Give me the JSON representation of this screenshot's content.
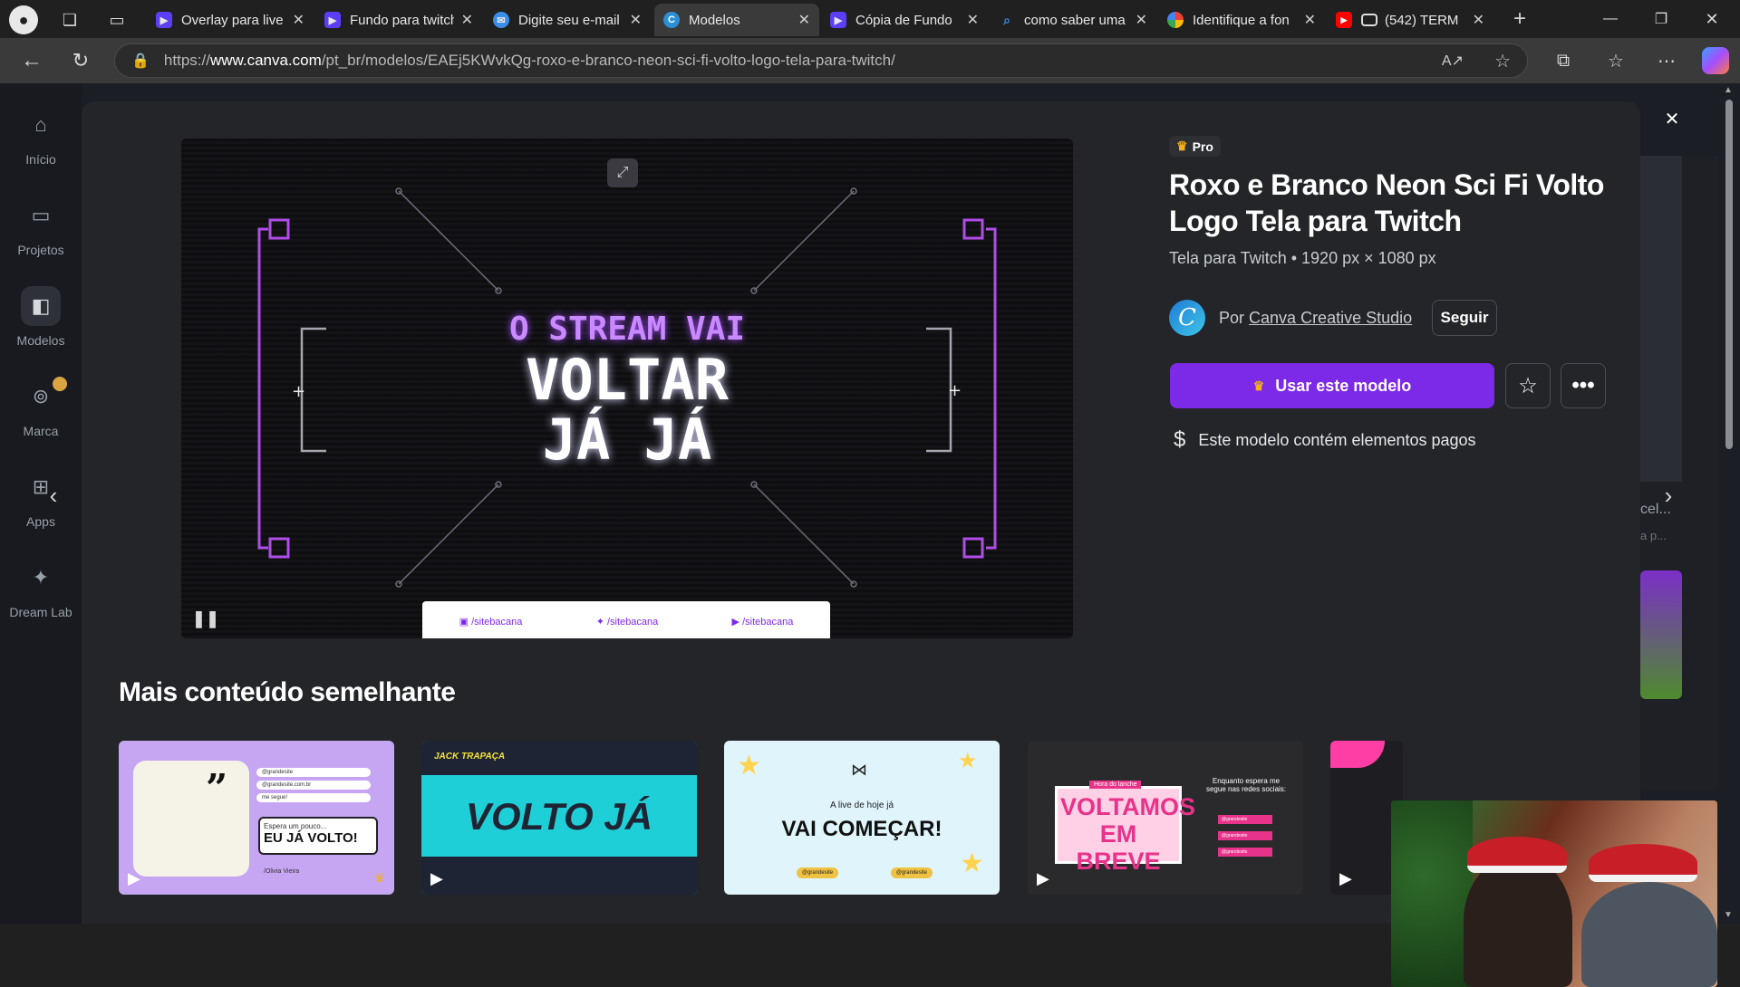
{
  "browser": {
    "tabs": [
      {
        "title": "Overlay para live",
        "favicon": "canva-video"
      },
      {
        "title": "Fundo para twitch",
        "favicon": "canva-video"
      },
      {
        "title": "Digite seu e-mail",
        "favicon": "mail"
      },
      {
        "title": "Modelos",
        "favicon": "canva",
        "active": true
      },
      {
        "title": "Cópia de Fundo",
        "favicon": "canva-video"
      },
      {
        "title": "como saber uma",
        "favicon": "search"
      },
      {
        "title": "Identifique a fon",
        "favicon": "google"
      },
      {
        "title": "(542) TERM",
        "favicon": "youtube"
      }
    ],
    "url_prefix": "https://",
    "url_domain": "www.canva.com",
    "url_path": "/pt_br/modelos/EAEj5KWvkQg-roxo-e-branco-neon-sci-fi-volto-logo-tela-para-twitch/"
  },
  "sidebar": {
    "items": [
      {
        "label": "Início",
        "icon": "home-icon"
      },
      {
        "label": "Projetos",
        "icon": "folder-icon"
      },
      {
        "label": "Modelos",
        "icon": "templates-icon"
      },
      {
        "label": "Marca",
        "icon": "brand-icon"
      },
      {
        "label": "Apps",
        "icon": "apps-icon"
      },
      {
        "label": "Dream Lab",
        "icon": "dreamlab-icon"
      }
    ]
  },
  "template": {
    "badge": "Pro",
    "title": "Roxo e Branco Neon Sci Fi Volto Logo Tela para Twitch",
    "meta": "Tela para Twitch • 1920 px × 1080 px",
    "author_prefix": "Por",
    "author": "Canva Creative Studio",
    "follow_label": "Seguir",
    "use_label": "Usar este modelo",
    "paid_note": "Este modelo contém elementos pagos"
  },
  "preview": {
    "line1": "O STREAM VAI",
    "line2": "VOLTAR",
    "line3": "JÁ JÁ",
    "socials": [
      "/sitebacana",
      "/sitebacana",
      "/sitebacana"
    ]
  },
  "similar": {
    "heading": "Mais conteúdo semelhante",
    "cards": [
      {
        "text": "EU JÁ VOLTO!",
        "sub": "Espera um pouco...",
        "handles": [
          "@grandesite",
          "@grandesite.com.br",
          "me segue!"
        ],
        "signature": "/Olivia Vieira"
      },
      {
        "text": "VOLTO JÁ",
        "sub": "JACK TRAPAÇA"
      },
      {
        "text": "VAI COMEÇAR!",
        "sub": "A live de hoje já",
        "handles": [
          "@grandesite",
          "@grandesite"
        ]
      },
      {
        "text": "VOLTAMOS EM BREVE",
        "sub": "Hora do lanche",
        "side_text": "Enquanto espera me segue nas redes sociais:",
        "handles": [
          "@grandesite",
          "@grandesite",
          "@grandesite"
        ]
      }
    ]
  },
  "background_peek": {
    "text1": "cel...",
    "text2": "a p..."
  }
}
